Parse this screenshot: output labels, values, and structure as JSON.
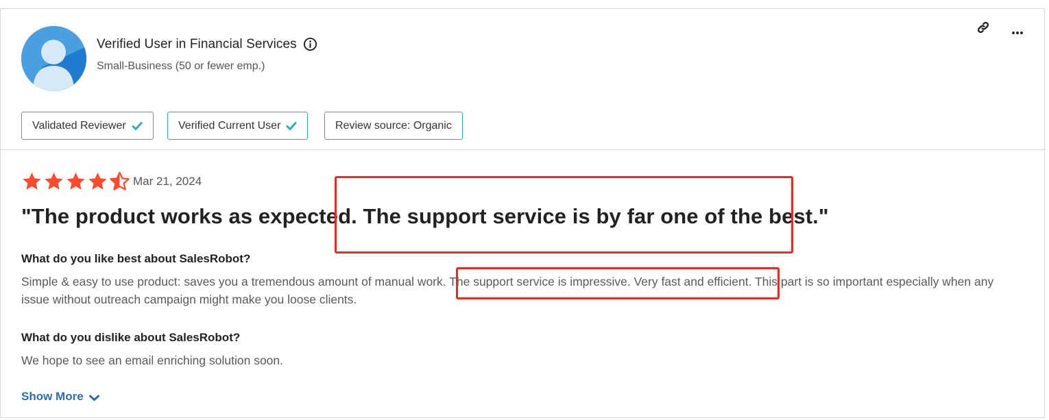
{
  "reviewer": {
    "name": "Verified User in Financial Services",
    "segment": "Small-Business (50 or fewer emp.)",
    "info_icon": "info-circle-icon",
    "avatar_icon": "user-silhouette-icon"
  },
  "actions": {
    "link_icon": "link-icon",
    "more_icon": "more-horizontal-icon"
  },
  "badges": [
    {
      "label": "Validated Reviewer",
      "check": true
    },
    {
      "label": "Verified Current User",
      "check": true
    },
    {
      "label": "Review source: Organic",
      "check": false
    }
  ],
  "review": {
    "rating": 4.5,
    "rating_max": 5,
    "date": "Mar 21, 2024",
    "title": "\"The product works as expected. The support service is by far one of the best.\"",
    "sections": [
      {
        "question": "What do you like best about SalesRobot?",
        "answer": "Simple & easy to use product: saves you a tremendous amount of manual work. The support service is impressive. Very fast and efficient. This part is so important especially when any issue without outreach campaign might make you loose clients."
      },
      {
        "question": "What do you dislike about SalesRobot?",
        "answer": "We hope to see an email enriching solution soon."
      }
    ],
    "show_more_label": "Show More"
  },
  "colors": {
    "star": "#ff492c",
    "badge_border": "#2ab3a6",
    "check": "#2ab3a6",
    "link": "#2a6db0",
    "highlight": "#ea2a22",
    "avatar_bg": "#4a9fe0"
  }
}
